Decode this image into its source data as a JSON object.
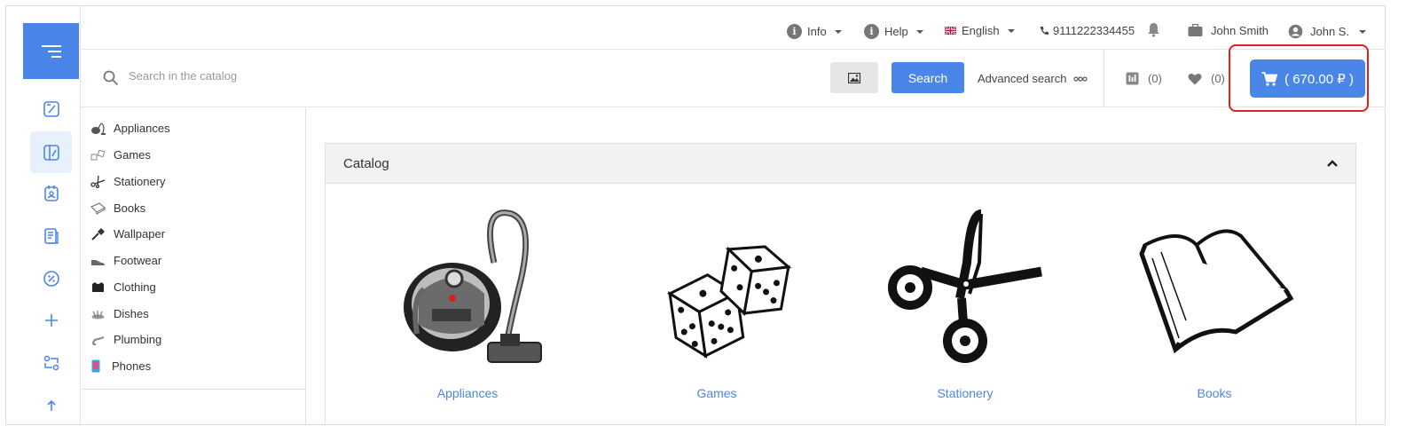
{
  "topbar": {
    "info_label": "Info",
    "help_label": "Help",
    "language_label": "English",
    "phone_label": "9111222334455",
    "company_label": "John Smith",
    "user_label": "John S."
  },
  "search": {
    "placeholder": "Search in the catalog",
    "button_label": "Search",
    "advanced_label": "Advanced search",
    "compare_count": "(0)",
    "favorites_count": "(0)",
    "cart_label": "( 670.00 ₽ )"
  },
  "sidebar": {
    "items": [
      {
        "icon": "edit-icon"
      },
      {
        "icon": "catalog-icon"
      },
      {
        "icon": "calendar-icon"
      },
      {
        "icon": "documents-icon"
      },
      {
        "icon": "percent-icon"
      },
      {
        "icon": "plus-icon"
      },
      {
        "icon": "exchange-icon"
      },
      {
        "icon": "upload-icon"
      }
    ]
  },
  "categories": [
    {
      "label": "Appliances",
      "icon": "vacuum-icon"
    },
    {
      "label": "Games",
      "icon": "dice-icon"
    },
    {
      "label": "Stationery",
      "icon": "scissors-icon"
    },
    {
      "label": "Books",
      "icon": "book-icon"
    },
    {
      "label": "Wallpaper",
      "icon": "brush-icon"
    },
    {
      "label": "Footwear",
      "icon": "shoe-icon"
    },
    {
      "label": "Clothing",
      "icon": "shirt-icon"
    },
    {
      "label": "Dishes",
      "icon": "dishes-icon"
    },
    {
      "label": "Plumbing",
      "icon": "faucet-icon"
    },
    {
      "label": "Phones",
      "icon": "phone-icon"
    }
  ],
  "catalog": {
    "title": "Catalog",
    "tiles": [
      {
        "label": "Appliances"
      },
      {
        "label": "Games"
      },
      {
        "label": "Stationery"
      },
      {
        "label": "Books"
      }
    ]
  },
  "colors": {
    "accent": "#4a86e8",
    "highlight": "#e02020"
  }
}
